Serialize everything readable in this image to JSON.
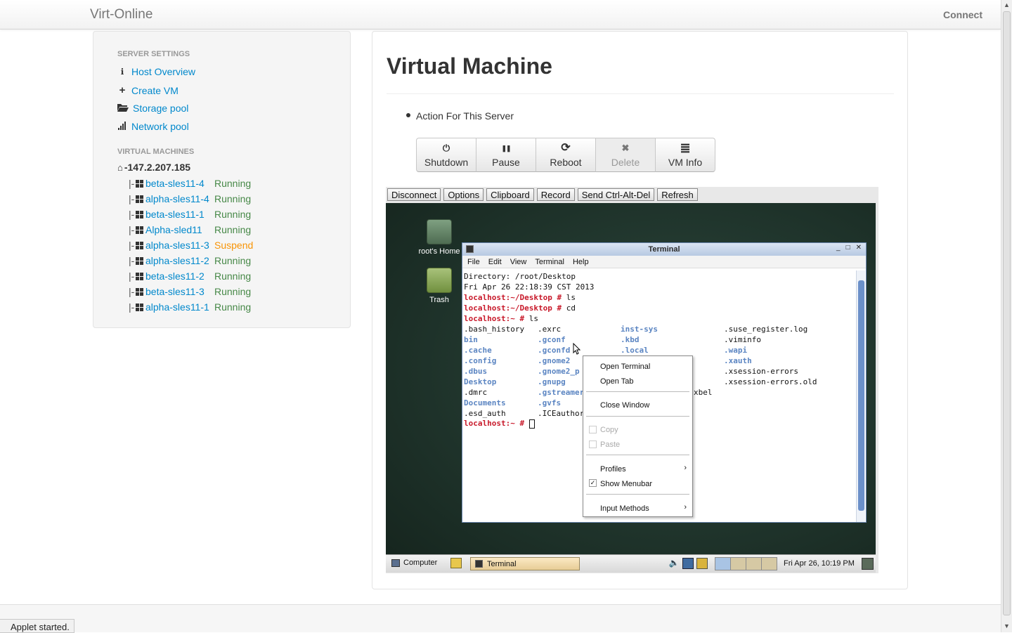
{
  "navbar": {
    "brand": "Virt-Online",
    "connect": "Connect"
  },
  "sidebar": {
    "server_header": "SERVER SETTINGS",
    "server_links": [
      {
        "icon": "info-icon",
        "label": "Host Overview"
      },
      {
        "icon": "plus-icon",
        "label": "Create VM"
      },
      {
        "icon": "folder-open-icon",
        "label": "Storage pool"
      },
      {
        "icon": "signal-icon",
        "label": "Network pool"
      }
    ],
    "vm_header": "VIRTUAL MACHINES",
    "host": "-147.2.207.185",
    "vms": [
      {
        "name": "beta-sles11-4",
        "status": "Running"
      },
      {
        "name": "alpha-sles11-4",
        "status": "Running"
      },
      {
        "name": "beta-sles11-1",
        "status": "Running"
      },
      {
        "name": "Alpha-sled11",
        "status": "Running"
      },
      {
        "name": "alpha-sles11-3",
        "status": "Suspend"
      },
      {
        "name": "alpha-sles11-2",
        "status": "Running"
      },
      {
        "name": "beta-sles11-2",
        "status": "Running"
      },
      {
        "name": "beta-sles11-3",
        "status": "Running"
      },
      {
        "name": "alpha-sles11-1",
        "status": "Running"
      }
    ],
    "tree_prefix": "|-"
  },
  "main": {
    "title": "Virtual Machine",
    "action_label": "Action For This Server",
    "buttons": [
      {
        "icon": "power-icon",
        "glyph": "⏻",
        "label": "Shutdown",
        "disabled": false
      },
      {
        "icon": "pause-icon",
        "glyph": "❚❚",
        "label": "Pause",
        "disabled": false
      },
      {
        "icon": "refresh-icon",
        "glyph": "⟳",
        "label": "Reboot",
        "disabled": false
      },
      {
        "icon": "remove-icon",
        "glyph": "✖",
        "label": "Delete",
        "disabled": true
      },
      {
        "icon": "list-icon",
        "glyph": "≣",
        "label": "VM Info",
        "disabled": false
      }
    ]
  },
  "vnc": {
    "toolbar": [
      "Disconnect",
      "Options",
      "Clipboard",
      "Record",
      "Send Ctrl-Alt-Del",
      "Refresh"
    ],
    "desktop_icons": {
      "home": "root's Home",
      "trash": "Trash"
    },
    "terminal": {
      "title": "Terminal",
      "menu": [
        "File",
        "Edit",
        "View",
        "Terminal",
        "Help"
      ],
      "line1": "Directory: /root/Desktop",
      "line2": "Fri Apr 26 22:18:39 CST 2013",
      "prompt_desktop": "localhost:~/Desktop #",
      "cmd_ls": " ls",
      "cmd_cd": " cd",
      "prompt_home": "localhost:~ #",
      "files": {
        "col1": [
          ".bash_history",
          "bin",
          ".cache",
          ".config",
          ".dbus",
          "Desktop",
          ".dmrc",
          "Documents",
          ".esd_auth"
        ],
        "col2": [
          ".exrc",
          ".gconf",
          ".gconfd",
          ".gnome2",
          ".gnome2_p",
          ".gnupg",
          ".gstreamer",
          ".gvfs",
          ".ICEauthor"
        ],
        "col3": [
          "inst-sys",
          ".kbd",
          ".local",
          "",
          "",
          "",
          "xbel"
        ],
        "col4": [
          ".suse_register.log",
          ".viminfo",
          ".wapi",
          ".xauth",
          ".xsession-errors",
          ".xsession-errors.old"
        ]
      }
    },
    "context_menu": {
      "open_terminal": "Open Terminal",
      "open_tab": "Open Tab",
      "close_window": "Close Window",
      "copy": "Copy",
      "paste": "Paste",
      "profiles": "Profiles",
      "show_menubar": "Show Menubar",
      "input_methods": "Input Methods"
    },
    "panel": {
      "computer": "Computer",
      "task": "Terminal",
      "clock": "Fri Apr 26, 10:19 PM"
    }
  },
  "status": {
    "message": "Applet started."
  }
}
